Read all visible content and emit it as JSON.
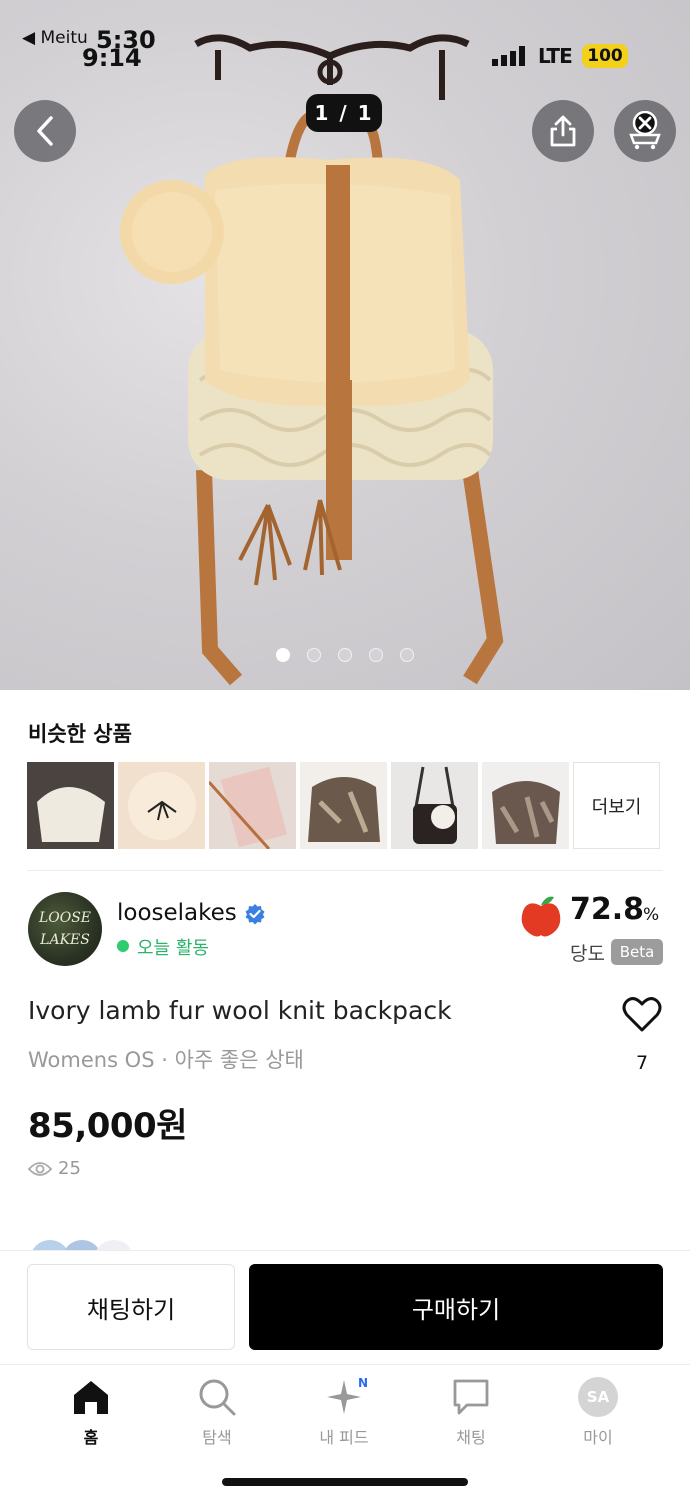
{
  "status_bar": {
    "back_app": "◀ Meitu",
    "time_front": "5:30",
    "time_back": "9:14",
    "network": "LTE",
    "battery": "100"
  },
  "image_viewer": {
    "counter": "1 / 1",
    "page_count": 5,
    "active_page": 1
  },
  "similar": {
    "title": "비슷한 상품",
    "more_label": "더보기",
    "thumbnail_count": 6
  },
  "seller": {
    "avatar_text_line1": "LOOSE",
    "avatar_text_line2": "LAKES",
    "name": "looselakes",
    "activity": "오늘 활동",
    "score": "72.8",
    "score_unit": "%",
    "score_label": "당도",
    "score_badge": "Beta"
  },
  "product": {
    "title": "Ivory lamb fur wool knit backpack",
    "meta": "Womens OS · 아주 좋은 상태",
    "price": "85,000원",
    "views": "25",
    "likes": "7"
  },
  "actions": {
    "chat": "채팅하기",
    "buy": "구매하기"
  },
  "tabs": [
    {
      "label": "홈"
    },
    {
      "label": "탐색"
    },
    {
      "label": "내 피드",
      "badge": "N"
    },
    {
      "label": "채팅"
    },
    {
      "label": "마이",
      "avatar": "SA"
    }
  ],
  "colors": {
    "activity_green": "#2bb36a",
    "battery_yellow": "#f3d11a",
    "buy_button": "#000000",
    "badge_blue": "#2a6cf0"
  }
}
